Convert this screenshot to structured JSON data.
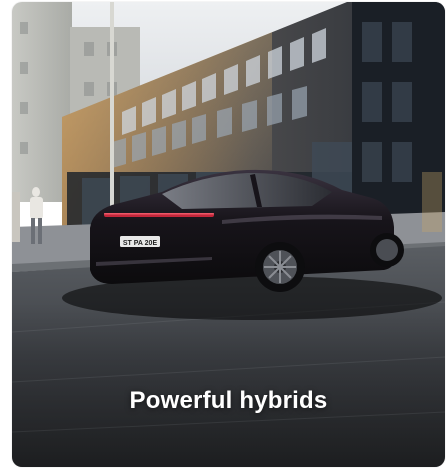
{
  "card": {
    "title": "Powerful hybrids",
    "license_plate": "ST PA 20E"
  },
  "colors": {
    "car_body": "#141216",
    "road": "#3a3d42",
    "building": "#2a3038",
    "sky": "#d9dde2",
    "caption_text": "#ffffff"
  },
  "icons": []
}
